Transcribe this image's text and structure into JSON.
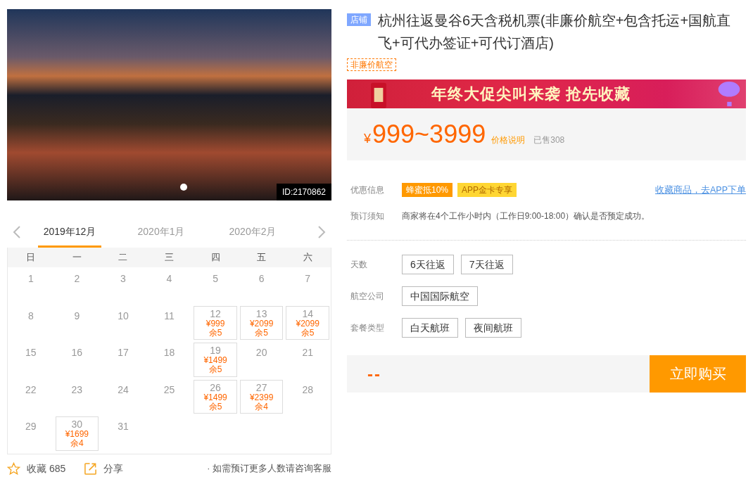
{
  "gallery": {
    "image_id": "ID:2170862",
    "dots": [
      {
        "selected": true
      }
    ]
  },
  "calendar": {
    "months": [
      {
        "label": "2019年12月",
        "selected": true
      },
      {
        "label": "2020年1月",
        "selected": false
      },
      {
        "label": "2020年2月",
        "selected": false
      }
    ],
    "weekdays": [
      "日",
      "一",
      "二",
      "三",
      "四",
      "五",
      "六"
    ],
    "days": [
      {
        "day": "1"
      },
      {
        "day": "2"
      },
      {
        "day": "3"
      },
      {
        "day": "4"
      },
      {
        "day": "5"
      },
      {
        "day": "6"
      },
      {
        "day": "7"
      },
      {
        "day": "8"
      },
      {
        "day": "9"
      },
      {
        "day": "10"
      },
      {
        "day": "11"
      },
      {
        "day": "12",
        "price": "¥999",
        "stock": "余5"
      },
      {
        "day": "13",
        "price": "¥2099",
        "stock": "余5"
      },
      {
        "day": "14",
        "price": "¥2099",
        "stock": "余5"
      },
      {
        "day": "15"
      },
      {
        "day": "16"
      },
      {
        "day": "17"
      },
      {
        "day": "18"
      },
      {
        "day": "19",
        "price": "¥1499",
        "stock": "余5"
      },
      {
        "day": "20"
      },
      {
        "day": "21"
      },
      {
        "day": "22"
      },
      {
        "day": "23"
      },
      {
        "day": "24"
      },
      {
        "day": "25"
      },
      {
        "day": "26",
        "price": "¥1499",
        "stock": "余5"
      },
      {
        "day": "27",
        "price": "¥2399",
        "stock": "余4"
      },
      {
        "day": "28"
      },
      {
        "day": "29"
      },
      {
        "day": "30",
        "price": "¥1699",
        "stock": "余4"
      },
      {
        "day": "31"
      }
    ]
  },
  "actions": [
    {
      "kind": "favorite",
      "label": "收藏 685"
    },
    {
      "kind": "share",
      "label": "分享"
    }
  ],
  "booking_note": "· 如需预订更多人数请咨询客服",
  "product": {
    "shop_badge": "店铺",
    "title": "杭州往返曼谷6天含税机票(非廉价航空+包含托运+国航直飞+可代办签证+可代订酒店)",
    "tags": [
      "非廉价航空"
    ]
  },
  "banner": {
    "text": "年终大促尖叫来袭 抢先收藏"
  },
  "price": {
    "currency": "¥",
    "range": "999~3999",
    "note_link": "价格说明",
    "sold": "已售308"
  },
  "offers": {
    "label": "优惠信息",
    "badges": [
      {
        "text": "蜂蜜抵10%",
        "color": "#ff9900"
      },
      {
        "text": "APP金卡专享",
        "color": "#ffd633"
      }
    ],
    "link": "收藏商品，去APP下单"
  },
  "notice": {
    "label": "预订须知",
    "text": "商家将在4个工作小时内（工作日9:00-18:00）确认是否预定成功。"
  },
  "options": [
    {
      "label": "天数",
      "choices": [
        {
          "text": "6天往返",
          "selected": false
        },
        {
          "text": "7天往返",
          "selected": false
        }
      ]
    },
    {
      "label": "航空公司",
      "choices": [
        {
          "text": "中国国际航空",
          "selected": false
        }
      ]
    },
    {
      "label": "套餐类型",
      "choices": [
        {
          "text": "白天航班",
          "selected": false
        },
        {
          "text": "夜间航班",
          "selected": false
        }
      ]
    }
  ],
  "buy": {
    "total": "--",
    "button": "立即购买"
  }
}
